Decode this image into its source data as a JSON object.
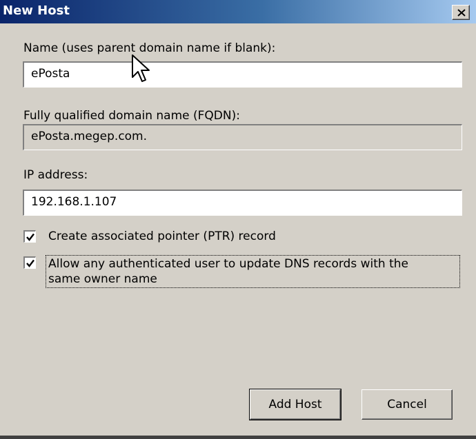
{
  "window": {
    "title": "New Host"
  },
  "name_field": {
    "label": "Name (uses parent domain name if blank):",
    "value": "ePosta"
  },
  "fqdn_field": {
    "label": "Fully qualified domain name (FQDN):",
    "value": "ePosta.megep.com."
  },
  "ip_field": {
    "label": "IP address:",
    "value": "192.168.1.107"
  },
  "options": {
    "ptr_label": "Create associated pointer (PTR) record",
    "ptr_checked": true,
    "allow_label_line1": "Allow any authenticated user to update DNS records with the",
    "allow_label_line2": "same owner name",
    "allow_checked": true
  },
  "buttons": {
    "add_host": "Add Host",
    "cancel": "Cancel"
  }
}
